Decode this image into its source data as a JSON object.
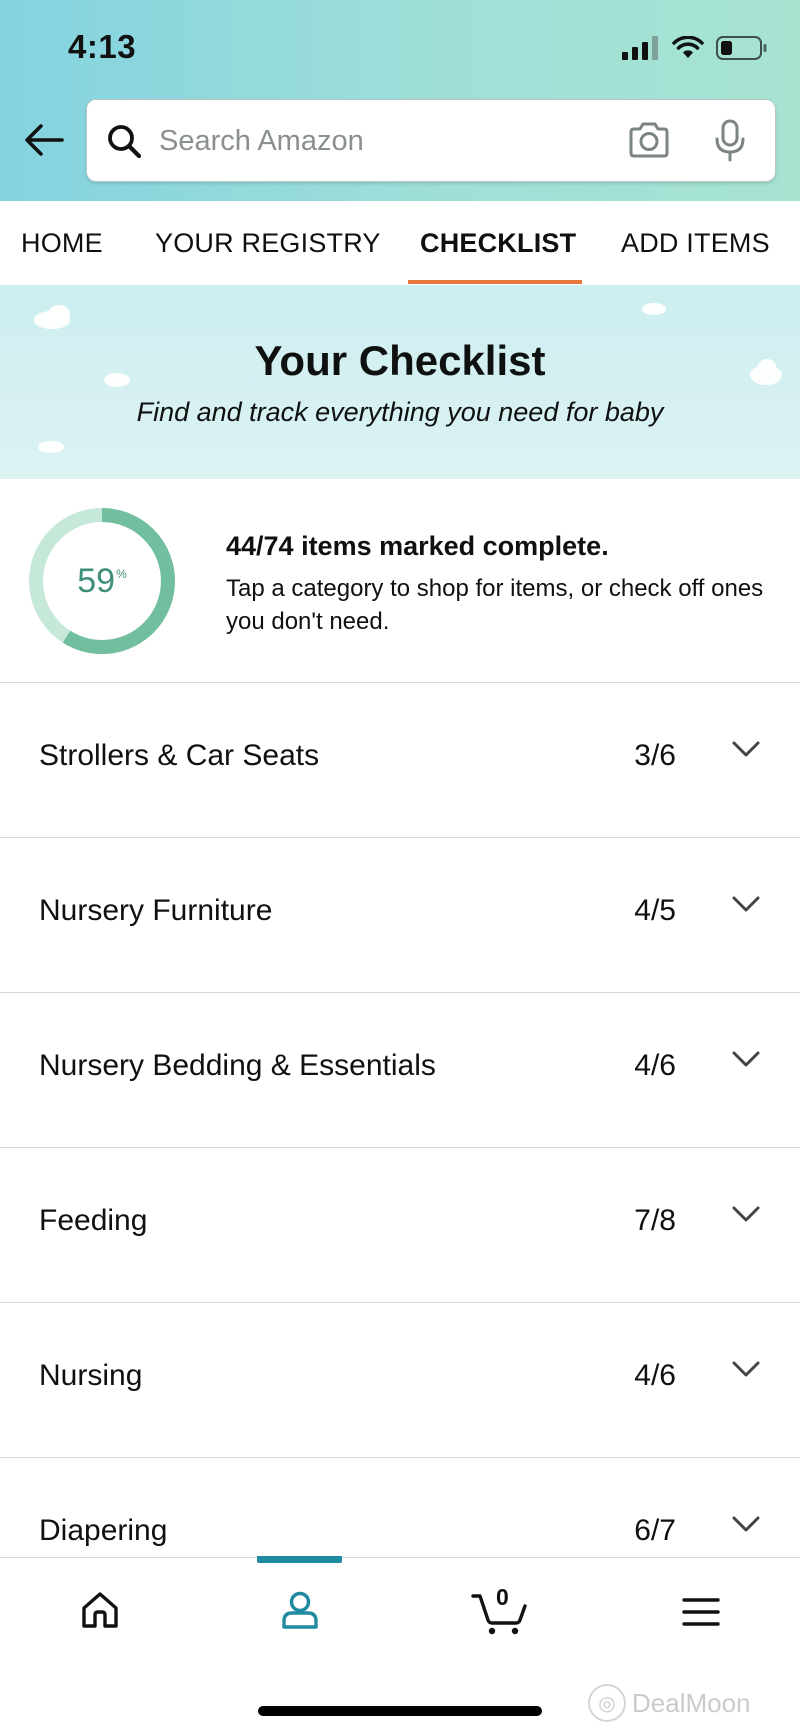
{
  "status_bar": {
    "time": "4:13"
  },
  "search": {
    "placeholder": "Search Amazon"
  },
  "tabs": [
    {
      "label": "HOME"
    },
    {
      "label": "YOUR REGISTRY"
    },
    {
      "label": "CHECKLIST",
      "active": true
    },
    {
      "label": "ADD ITEMS"
    }
  ],
  "banner": {
    "title": "Your Checklist",
    "subtitle": "Find and track everything you need for baby"
  },
  "progress": {
    "percent_value": "59",
    "percent_sign": "%",
    "fraction_complete": 0.59,
    "summary": "44/74 items marked complete.",
    "description": "Tap a category to shop for items, or check off ones you don't need."
  },
  "categories": [
    {
      "name": "Strollers & Car Seats",
      "count": "3/6"
    },
    {
      "name": "Nursery Furniture",
      "count": "4/5"
    },
    {
      "name": "Nursery Bedding & Essentials",
      "count": "4/6"
    },
    {
      "name": "Feeding",
      "count": "7/8"
    },
    {
      "name": "Nursing",
      "count": "4/6"
    },
    {
      "name": "Diapering",
      "count": "6/7"
    }
  ],
  "bottom_nav": {
    "items": [
      {
        "icon": "home-icon"
      },
      {
        "icon": "profile-icon",
        "active": true
      },
      {
        "icon": "cart-icon"
      },
      {
        "icon": "menu-icon"
      }
    ],
    "cart_count": "0"
  },
  "watermark": {
    "text": "DealMoon"
  },
  "colors": {
    "header_gradient_start": "#83d3e0",
    "header_gradient_end": "#a6e3d1",
    "tab_active_underline": "#e77a3a",
    "progress_ring": "#72bf9f",
    "progress_track": "#c5e8d9",
    "progress_text": "#3f8f7a",
    "nav_active": "#1f8aa0"
  }
}
